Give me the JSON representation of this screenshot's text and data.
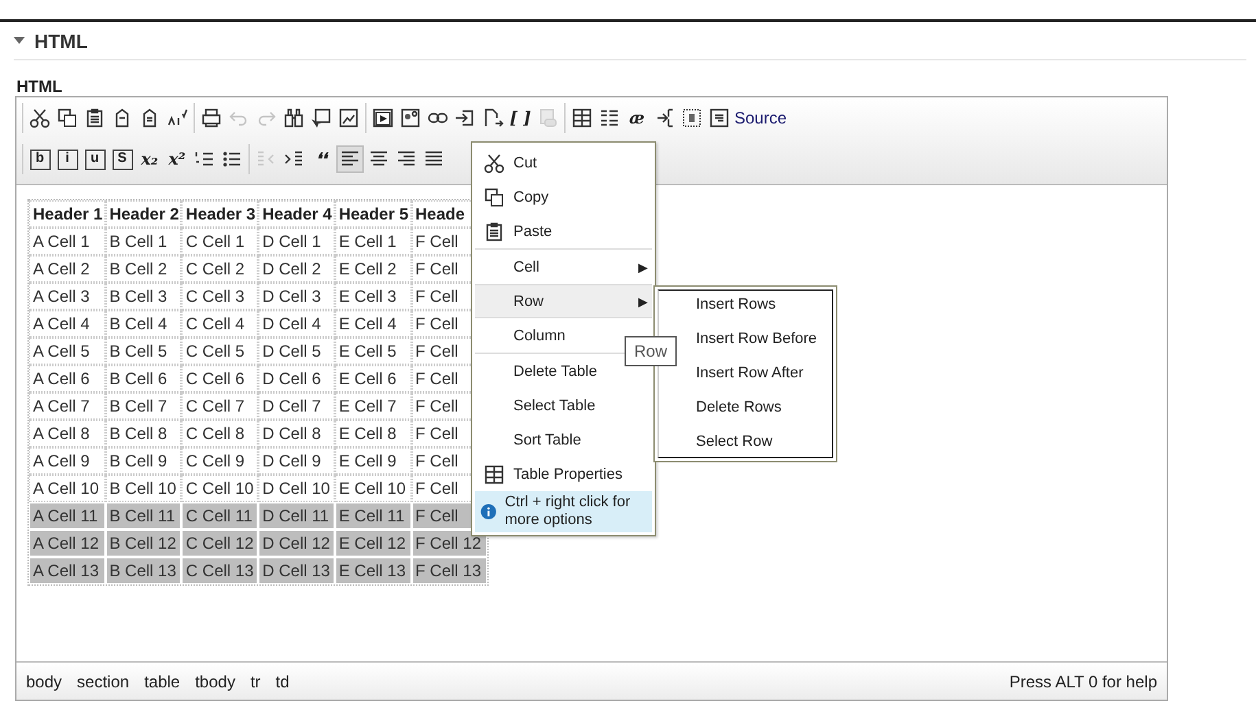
{
  "section": {
    "title": "HTML",
    "expanded": true
  },
  "field_label": "HTML",
  "toolbar": [
    [
      [
        {
          "kind": "icon"
        },
        {
          "kind": "icon"
        },
        {
          "kind": "icon"
        },
        {
          "kind": "icon"
        },
        {
          "kind": "icon"
        },
        {
          "kind": "icon"
        }
      ],
      [
        {
          "kind": "icon"
        },
        {
          "kind": "icon",
          "disabled": true
        },
        {
          "kind": "icon",
          "disabled": true
        },
        {
          "kind": "icon"
        },
        {
          "kind": "icon"
        },
        {
          "kind": "icon"
        }
      ],
      [
        {
          "kind": "icon"
        },
        {
          "kind": "icon"
        },
        {
          "kind": "icon"
        },
        {
          "kind": "icon"
        },
        {
          "kind": "icon"
        },
        {
          "kind": "glyph",
          "label": "[ ]"
        },
        {
          "kind": "icon",
          "disabled": true
        }
      ],
      [
        {
          "kind": "icon"
        },
        {
          "kind": "icon"
        },
        {
          "kind": "glyph",
          "label": "æ"
        },
        {
          "kind": "icon"
        },
        {
          "kind": "icon"
        },
        {
          "kind": "labeled",
          "label": "Source"
        }
      ]
    ],
    [
      [
        {
          "kind": "boxed",
          "label": "b"
        },
        {
          "kind": "boxed",
          "label": "i"
        },
        {
          "kind": "boxed",
          "label": "u"
        },
        {
          "kind": "boxed",
          "label": "S"
        },
        {
          "kind": "glyph",
          "label": "x₂"
        },
        {
          "kind": "glyph",
          "label": "x²"
        },
        {
          "kind": "icon"
        },
        {
          "kind": "icon"
        }
      ],
      [
        {
          "kind": "icon",
          "disabled": true
        },
        {
          "kind": "icon"
        },
        {
          "kind": "glyph",
          "label": "❛❛"
        },
        {
          "kind": "icon",
          "selected": true
        },
        {
          "kind": "icon"
        },
        {
          "kind": "icon"
        },
        {
          "kind": "icon"
        }
      ]
    ]
  ],
  "table": {
    "headers": [
      "Header 1",
      "Header 2",
      "Header 3",
      "Header 4",
      "Header 5",
      "Heade"
    ],
    "rows": [
      {
        "selected": false,
        "cells": [
          "A Cell 1",
          "B Cell 1",
          "C Cell 1",
          "D Cell 1",
          "E Cell 1",
          "F Cell"
        ]
      },
      {
        "selected": false,
        "cells": [
          "A Cell 2",
          "B Cell 2",
          "C Cell 2",
          "D Cell 2",
          "E Cell 2",
          "F Cell"
        ]
      },
      {
        "selected": false,
        "cells": [
          "A Cell 3",
          "B Cell 3",
          "C Cell 3",
          "D Cell 3",
          "E Cell 3",
          "F Cell"
        ]
      },
      {
        "selected": false,
        "cells": [
          "A Cell 4",
          "B Cell 4",
          "C Cell 4",
          "D Cell 4",
          "E Cell 4",
          "F Cell"
        ]
      },
      {
        "selected": false,
        "cells": [
          "A Cell 5",
          "B Cell 5",
          "C Cell 5",
          "D Cell 5",
          "E Cell 5",
          "F Cell"
        ]
      },
      {
        "selected": false,
        "cells": [
          "A Cell 6",
          "B Cell 6",
          "C Cell 6",
          "D Cell 6",
          "E Cell 6",
          "F Cell"
        ]
      },
      {
        "selected": false,
        "cells": [
          "A Cell 7",
          "B Cell 7",
          "C Cell 7",
          "D Cell 7",
          "E Cell 7",
          "F Cell"
        ]
      },
      {
        "selected": false,
        "cells": [
          "A Cell 8",
          "B Cell 8",
          "C Cell 8",
          "D Cell 8",
          "E Cell 8",
          "F Cell"
        ]
      },
      {
        "selected": false,
        "cells": [
          "A Cell 9",
          "B Cell 9",
          "C Cell 9",
          "D Cell 9",
          "E Cell 9",
          "F Cell"
        ]
      },
      {
        "selected": false,
        "cells": [
          "A Cell 10",
          "B Cell 10",
          "C Cell 10",
          "D Cell 10",
          "E Cell 10",
          "F Cell"
        ]
      },
      {
        "selected": true,
        "cells": [
          "A Cell 11",
          "B Cell 11",
          "C Cell 11",
          "D Cell 11",
          "E Cell 11",
          "F Cell"
        ]
      },
      {
        "selected": true,
        "cells": [
          "A Cell 12",
          "B Cell 12",
          "C Cell 12",
          "D Cell 12",
          "E Cell 12",
          "F Cell 12"
        ]
      },
      {
        "selected": true,
        "cells": [
          "A Cell 13",
          "B Cell 13",
          "C Cell 13",
          "D Cell 13",
          "E Cell 13",
          "F Cell 13"
        ]
      }
    ]
  },
  "context_menu": [
    [
      {
        "kind": "item",
        "label": "Cut",
        "selected": false
      },
      {
        "kind": "item",
        "label": "Copy",
        "selected": false
      },
      {
        "kind": "item",
        "label": "Paste",
        "selected": false
      }
    ],
    [
      {
        "kind": "submenu",
        "label": "Cell",
        "selected": false,
        "arrow": "▶"
      },
      {
        "kind": "submenu",
        "label": "Row",
        "selected": true,
        "arrow": "▶"
      },
      {
        "kind": "item",
        "label": "Column",
        "selected": false
      }
    ],
    [
      {
        "kind": "item",
        "label": "Delete Table",
        "selected": false
      },
      {
        "kind": "item",
        "label": "Select Table",
        "selected": false
      },
      {
        "kind": "item",
        "label": "Sort Table",
        "selected": false
      },
      {
        "kind": "item",
        "label": "Table Properties",
        "selected": false
      },
      {
        "kind": "info",
        "label": "Ctrl + right click for more options"
      }
    ]
  ],
  "submenu": [
    "Insert Rows",
    "Insert Row Before",
    "Insert Row After",
    "Delete Rows",
    "Select Row"
  ],
  "tooltip": "Row",
  "status_bar": {
    "path": [
      "body",
      "section",
      "table",
      "tbody",
      "tr",
      "td"
    ],
    "help": "Press ALT 0 for help"
  }
}
